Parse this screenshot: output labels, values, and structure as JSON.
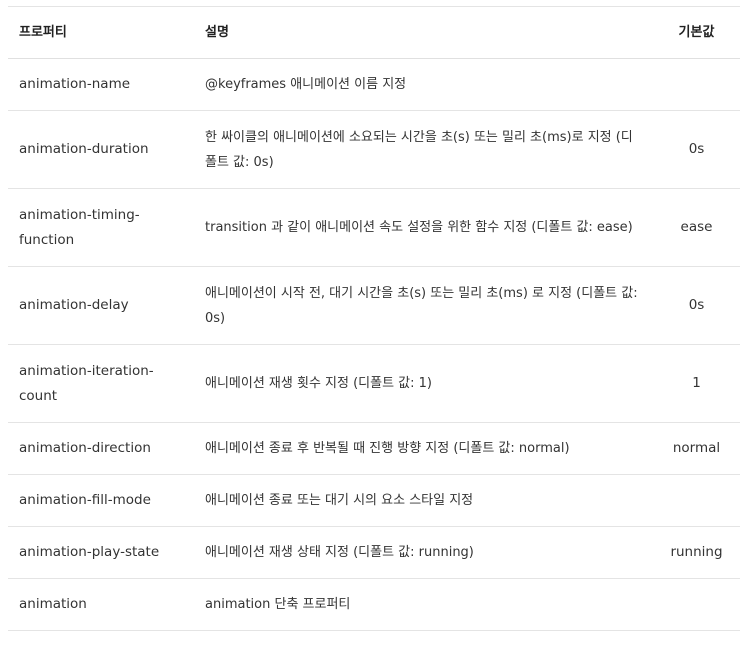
{
  "header": {
    "property": "프로퍼티",
    "description": "설명",
    "default": "기본값"
  },
  "rows": [
    {
      "property": "animation-name",
      "description": "@keyframes 애니메이션 이름 지정",
      "default": ""
    },
    {
      "property": "animation-duration",
      "description": "한 싸이클의 애니메이션에 소요되는 시간을 초(s) 또는 밀리 초(ms)로 지정 (디폴트 값: 0s)",
      "default": "0s"
    },
    {
      "property": "animation-timing-function",
      "description": "transition 과 같이 애니메이션 속도 설정을 위한 함수 지정 (디폴트 값: ease)",
      "default": "ease"
    },
    {
      "property": "animation-delay",
      "description": "애니메이션이 시작 전, 대기 시간을 초(s) 또는 밀리 초(ms) 로 지정 (디폴트 값: 0s)",
      "default": "0s"
    },
    {
      "property": "animation-iteration-count",
      "description": "애니메이션 재생 횟수 지정 (디폴트 값: 1)",
      "default": "1"
    },
    {
      "property": "animation-direction",
      "description": "애니메이션 종료 후 반복될 때 진행 방향 지정 (디폴트 값: normal)",
      "default": "normal"
    },
    {
      "property": "animation-fill-mode",
      "description": "애니메이션 종료 또는 대기 시의 요소 스타일 지정",
      "default": ""
    },
    {
      "property": "animation-play-state",
      "description": "애니메이션 재생 상태 지정 (디폴트 값: running)",
      "default": "running"
    },
    {
      "property": "animation",
      "description": "animation 단축 프로퍼티",
      "default": ""
    }
  ]
}
